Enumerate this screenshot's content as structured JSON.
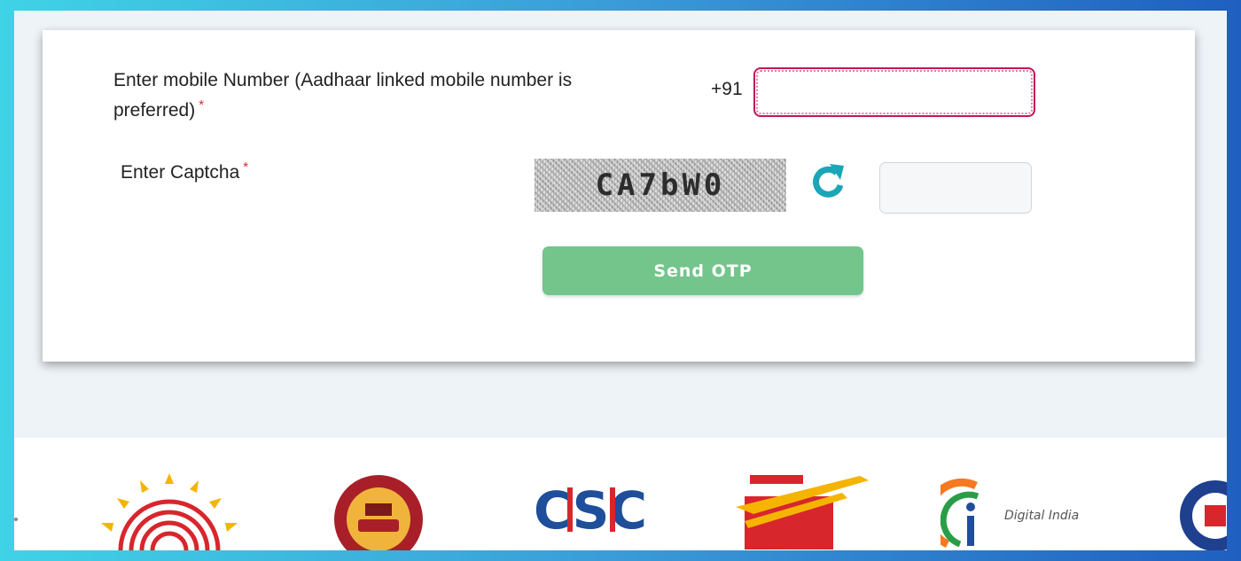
{
  "form": {
    "mobile_label": "Enter mobile Number (Aadhaar linked mobile number is preferred)",
    "required_mark": "*",
    "country_code": "+91",
    "mobile_value": "",
    "captcha_label": "Enter Captcha",
    "captcha_text": "CA7bW0",
    "captcha_value": "",
    "send_otp_label": "Send OTP"
  },
  "footer": {
    "csc_logo_text": "CSC",
    "digital_india_text": "Digital India"
  },
  "colors": {
    "send_otp_bg": "#73c58c",
    "refresh_icon": "#1aa6b7",
    "focus_border": "#c01856"
  }
}
